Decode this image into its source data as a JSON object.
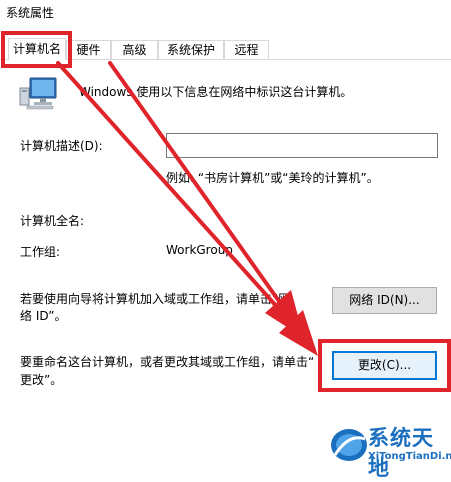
{
  "window": {
    "title": "系统属性"
  },
  "tabs": [
    {
      "label": "计算机名",
      "active": true
    },
    {
      "label": "硬件"
    },
    {
      "label": "高级"
    },
    {
      "label": "系统保护"
    },
    {
      "label": "远程"
    }
  ],
  "intro": {
    "text": "Windows 使用以下信息在网络中标识这台计算机。"
  },
  "description": {
    "label": "计算机描述(D):",
    "value": "",
    "example": "例如: “书房计算机”或“美玲的计算机”。"
  },
  "full_name": {
    "label": "计算机全名:",
    "value": ""
  },
  "workgroup": {
    "label": "工作组:",
    "value": "WorkGroup"
  },
  "network_id": {
    "text_line1": "若要使用向导将计算机加入域或工作组，请单击“网",
    "text_line2": "络 ID”。",
    "button_label": "网络 ID(N)..."
  },
  "rename": {
    "text_line1": "要重命名这台计算机，或者更改其域或工作组，请单击“",
    "text_line2": "更改”。",
    "button_label": "更改(C)..."
  },
  "annotation": {
    "color": "#e0242b"
  },
  "watermark": {
    "name": "系统天地",
    "url": "XiTongTianDi.net",
    "color": "#1b6fbf"
  }
}
